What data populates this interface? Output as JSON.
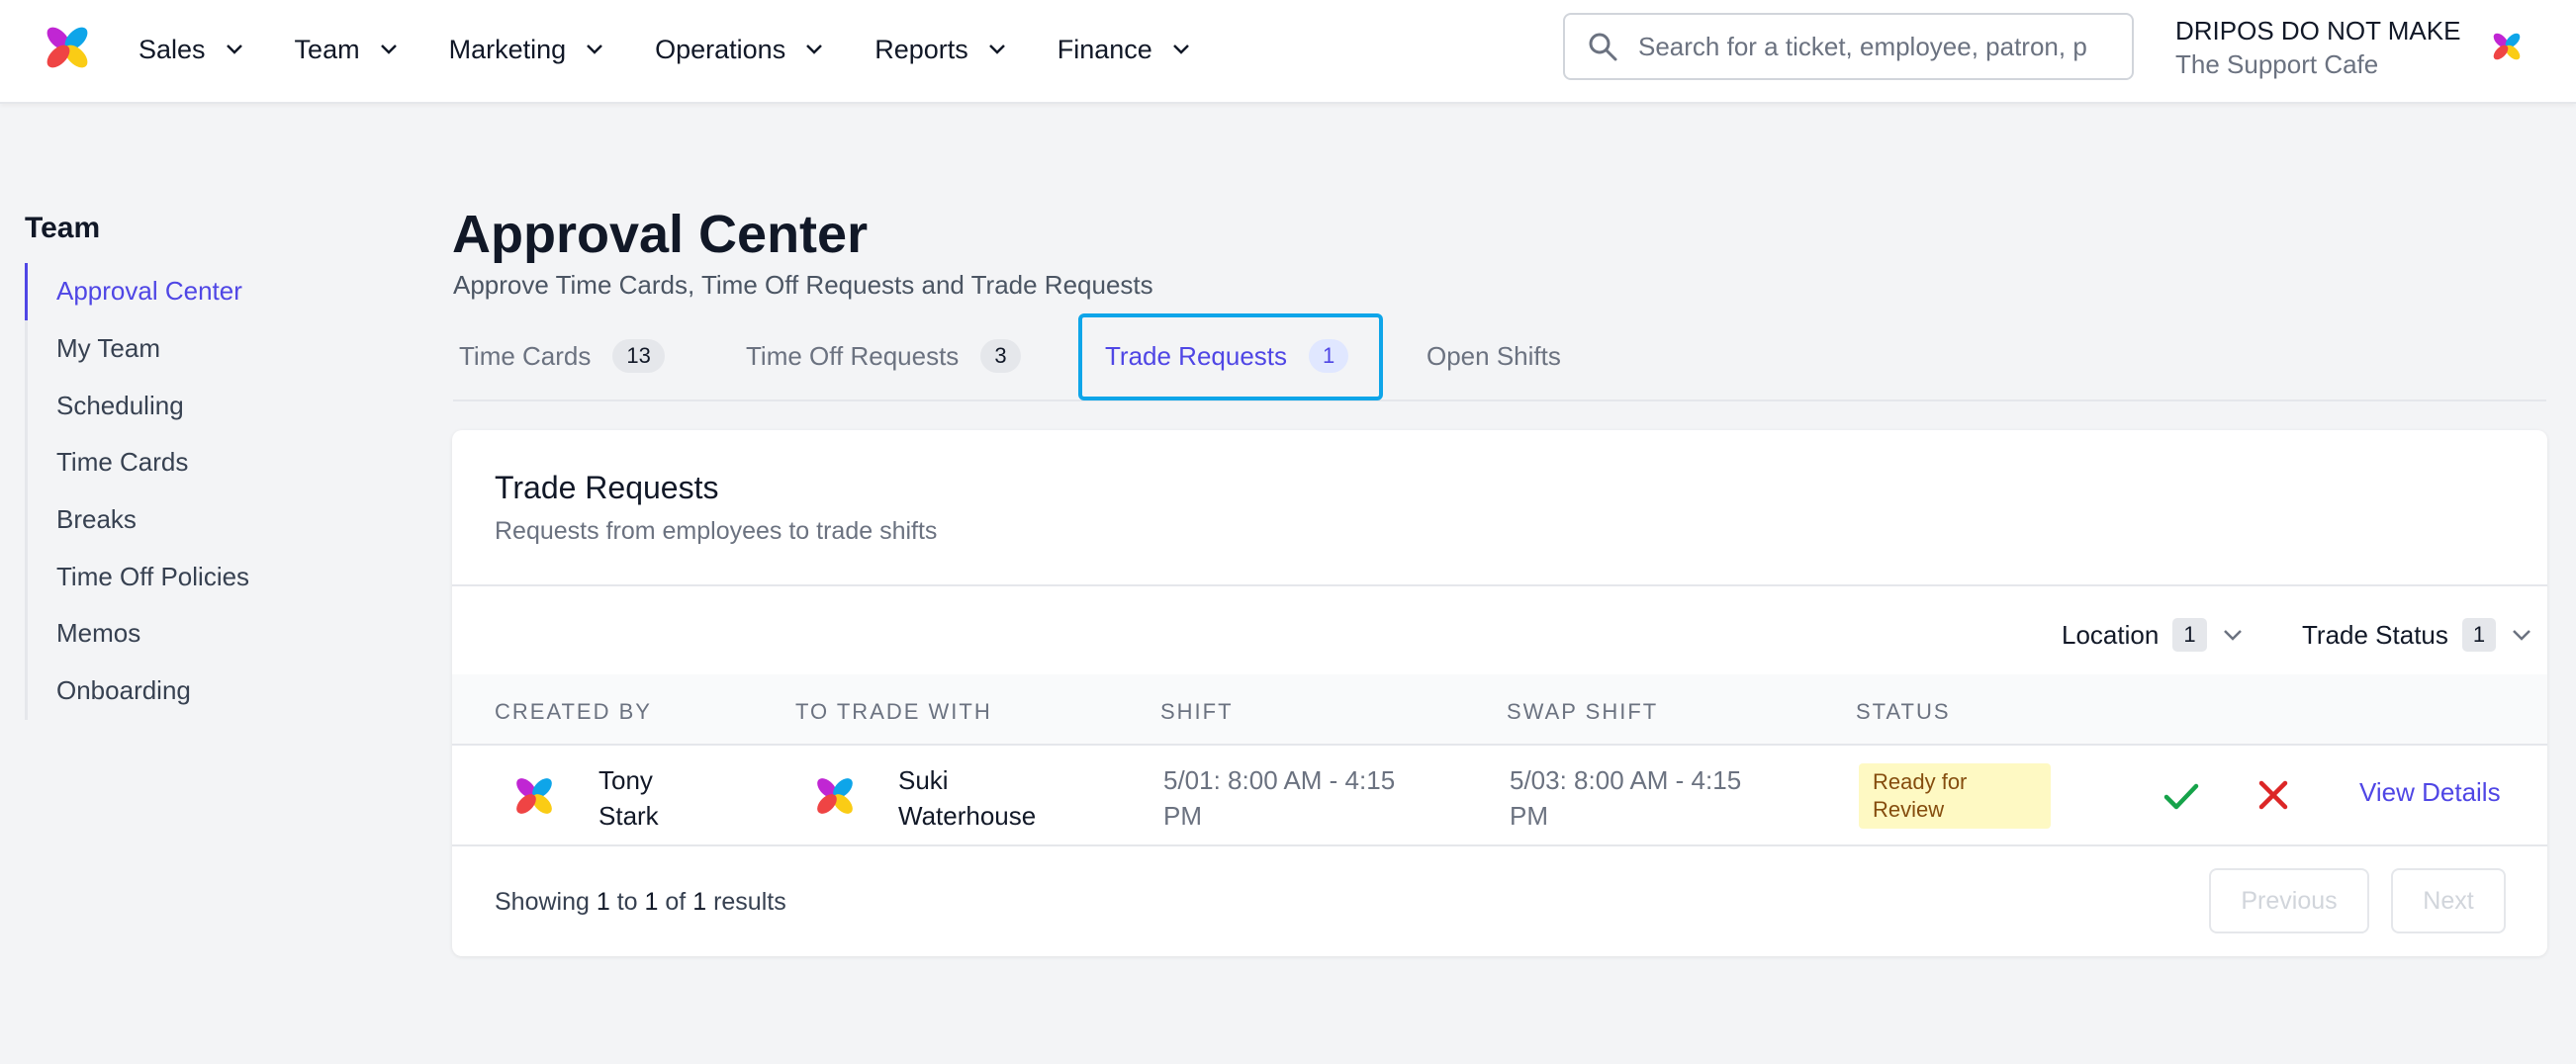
{
  "nav": {
    "items": [
      {
        "label": "Sales"
      },
      {
        "label": "Team"
      },
      {
        "label": "Marketing"
      },
      {
        "label": "Operations"
      },
      {
        "label": "Reports"
      },
      {
        "label": "Finance"
      }
    ]
  },
  "search": {
    "placeholder": "Search for a ticket, employee, patron, p"
  },
  "account": {
    "business": "DRIPOS DO NOT MAKE",
    "location": "The Support Cafe"
  },
  "sidebar": {
    "title": "Team",
    "items": [
      {
        "label": "Approval Center",
        "active": true
      },
      {
        "label": "My Team"
      },
      {
        "label": "Scheduling"
      },
      {
        "label": "Time Cards"
      },
      {
        "label": "Breaks"
      },
      {
        "label": "Time Off Policies"
      },
      {
        "label": "Memos"
      },
      {
        "label": "Onboarding"
      }
    ]
  },
  "page": {
    "title": "Approval Center",
    "subtitle": "Approve Time Cards, Time Off Requests and Trade Requests"
  },
  "tabs": [
    {
      "label": "Time Cards",
      "count": "13"
    },
    {
      "label": "Time Off Requests",
      "count": "3"
    },
    {
      "label": "Trade Requests",
      "count": "1",
      "active": true
    },
    {
      "label": "Open Shifts"
    }
  ],
  "card": {
    "title": "Trade Requests",
    "subtitle": "Requests from employees to trade shifts",
    "filters": [
      {
        "label": "Location",
        "count": "1"
      },
      {
        "label": "Trade Status",
        "count": "1"
      }
    ],
    "columns": [
      "CREATED BY",
      "TO TRADE WITH",
      "SHIFT",
      "SWAP SHIFT",
      "STATUS"
    ],
    "rows": [
      {
        "created_by_first": "Tony",
        "created_by_last": "Stark",
        "trade_with_first": "Suki",
        "trade_with_last": "Waterhouse",
        "shift_line1": "5/01: 8:00 AM - 4:15",
        "shift_line2": "PM",
        "swap_line1": "5/03: 8:00 AM - 4:15",
        "swap_line2": "PM",
        "status_line1": "Ready for",
        "status_line2": "Review",
        "view_label": "View Details"
      }
    ],
    "footer": {
      "showing_prefix": "Showing",
      "from": "1",
      "to_word": "to",
      "to": "1",
      "of_word": "of",
      "total": "1",
      "results_word": "results",
      "prev_label": "Previous",
      "next_label": "Next"
    }
  },
  "colors": {
    "accent": "#4f46e5",
    "focus_ring": "#0ea5e9",
    "approve": "#16a34a",
    "reject": "#dc2626",
    "status_bg": "#fef9c3",
    "status_text": "#854d0e"
  },
  "icons": {
    "logo": "dripos-pinwheel-logo",
    "search": "search-icon",
    "chevron": "chevron-down-icon",
    "approve": "check-icon",
    "reject": "x-icon"
  }
}
